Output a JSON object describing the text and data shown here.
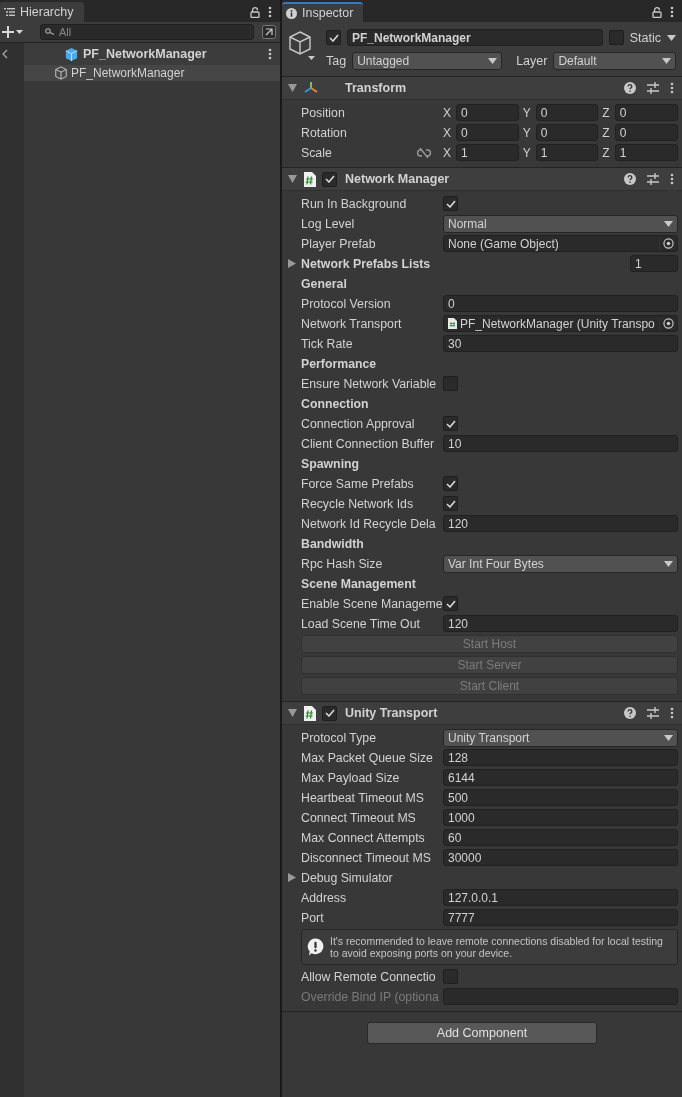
{
  "hierarchy": {
    "title": "Hierarchy",
    "search": {
      "placeholder": "All"
    },
    "prefab_title": "PF_NetworkManager",
    "items": [
      {
        "label": "PF_NetworkManager",
        "selected": true
      }
    ]
  },
  "inspector": {
    "title": "Inspector",
    "object": {
      "active": true,
      "name": "PF_NetworkManager",
      "static": false,
      "static_label": "Static",
      "tag_label": "Tag",
      "tag": "Untagged",
      "layer_label": "Layer",
      "layer": "Default"
    },
    "components": [
      {
        "title": "Transform",
        "expanded": true,
        "rows": [
          {
            "kind": "vector",
            "label": "Position",
            "fields": [
              {
                "axis": "X",
                "value": "0"
              },
              {
                "axis": "Y",
                "value": "0"
              },
              {
                "axis": "Z",
                "value": "0"
              }
            ]
          },
          {
            "kind": "vector",
            "label": "Rotation",
            "fields": [
              {
                "axis": "X",
                "value": "0"
              },
              {
                "axis": "Y",
                "value": "0"
              },
              {
                "axis": "Z",
                "value": "0"
              }
            ]
          },
          {
            "kind": "vector",
            "label": "Scale",
            "proportions_linked": false,
            "fields": [
              {
                "axis": "X",
                "value": "1"
              },
              {
                "axis": "Y",
                "value": "1"
              },
              {
                "axis": "Z",
                "value": "1"
              }
            ]
          }
        ]
      },
      {
        "title": "Network Manager",
        "enabled": true,
        "expanded": true,
        "rows": [
          {
            "kind": "check",
            "label": "Run In Background",
            "checked": true
          },
          {
            "kind": "dropdown",
            "label": "Log Level",
            "value": "Normal"
          },
          {
            "kind": "object",
            "label": "Player Prefab",
            "value": "None (Game Object)"
          },
          {
            "kind": "list",
            "label": "Network Prefabs Lists",
            "expanded": false,
            "value": "1"
          },
          {
            "kind": "header",
            "label": "General"
          },
          {
            "kind": "text",
            "label": "Protocol Version",
            "value": "0"
          },
          {
            "kind": "object",
            "label": "Network Transport",
            "value": "PF_NetworkManager (Unity Transpo",
            "script": true
          },
          {
            "kind": "text",
            "label": "Tick Rate",
            "value": "30"
          },
          {
            "kind": "header",
            "label": "Performance"
          },
          {
            "kind": "check",
            "label": "Ensure Network Variable",
            "checked": false
          },
          {
            "kind": "header",
            "label": "Connection"
          },
          {
            "kind": "check",
            "label": "Connection Approval",
            "checked": true
          },
          {
            "kind": "text",
            "label": "Client Connection Buffer",
            "value": "10"
          },
          {
            "kind": "header",
            "label": "Spawning"
          },
          {
            "kind": "check",
            "label": "Force Same Prefabs",
            "checked": true
          },
          {
            "kind": "check",
            "label": "Recycle Network Ids",
            "checked": true
          },
          {
            "kind": "text",
            "label": "Network Id Recycle Dela",
            "value": "120"
          },
          {
            "kind": "header",
            "label": "Bandwidth"
          },
          {
            "kind": "dropdown",
            "label": "Rpc Hash Size",
            "value": "Var Int Four Bytes"
          },
          {
            "kind": "header",
            "label": "Scene Management"
          },
          {
            "kind": "check",
            "label": "Enable Scene Manageme",
            "checked": true
          },
          {
            "kind": "text",
            "label": "Load Scene Time Out",
            "value": "120"
          },
          {
            "kind": "button",
            "label": "Start Host",
            "disabled": true
          },
          {
            "kind": "button",
            "label": "Start Server",
            "disabled": true
          },
          {
            "kind": "button",
            "label": "Start Client",
            "disabled": true
          }
        ]
      },
      {
        "title": "Unity Transport",
        "enabled": true,
        "expanded": true,
        "rows": [
          {
            "kind": "dropdown",
            "label": "Protocol Type",
            "value": "Unity Transport"
          },
          {
            "kind": "text",
            "label": "Max Packet Queue Size",
            "value": "128"
          },
          {
            "kind": "text",
            "label": "Max Payload Size",
            "value": "6144"
          },
          {
            "kind": "text",
            "label": "Heartbeat Timeout MS",
            "value": "500"
          },
          {
            "kind": "text",
            "label": "Connect Timeout MS",
            "value": "1000"
          },
          {
            "kind": "text",
            "label": "Max Connect Attempts",
            "value": "60"
          },
          {
            "kind": "text",
            "label": "Disconnect Timeout MS",
            "value": "30000"
          },
          {
            "kind": "foldout",
            "label": "Debug Simulator",
            "expanded": false
          },
          {
            "kind": "text",
            "label": "Address",
            "value": "127.0.0.1"
          },
          {
            "kind": "text",
            "label": "Port",
            "value": "7777"
          },
          {
            "kind": "help",
            "label": "It's recommended to leave remote connections disabled for local testing to avoid exposing ports on your device."
          },
          {
            "kind": "check",
            "label": "Allow Remote Connectio",
            "checked": false
          },
          {
            "kind": "text",
            "label": "Override Bind IP (optiona",
            "disabled": true
          }
        ]
      }
    ],
    "add_component": "Add Component"
  }
}
